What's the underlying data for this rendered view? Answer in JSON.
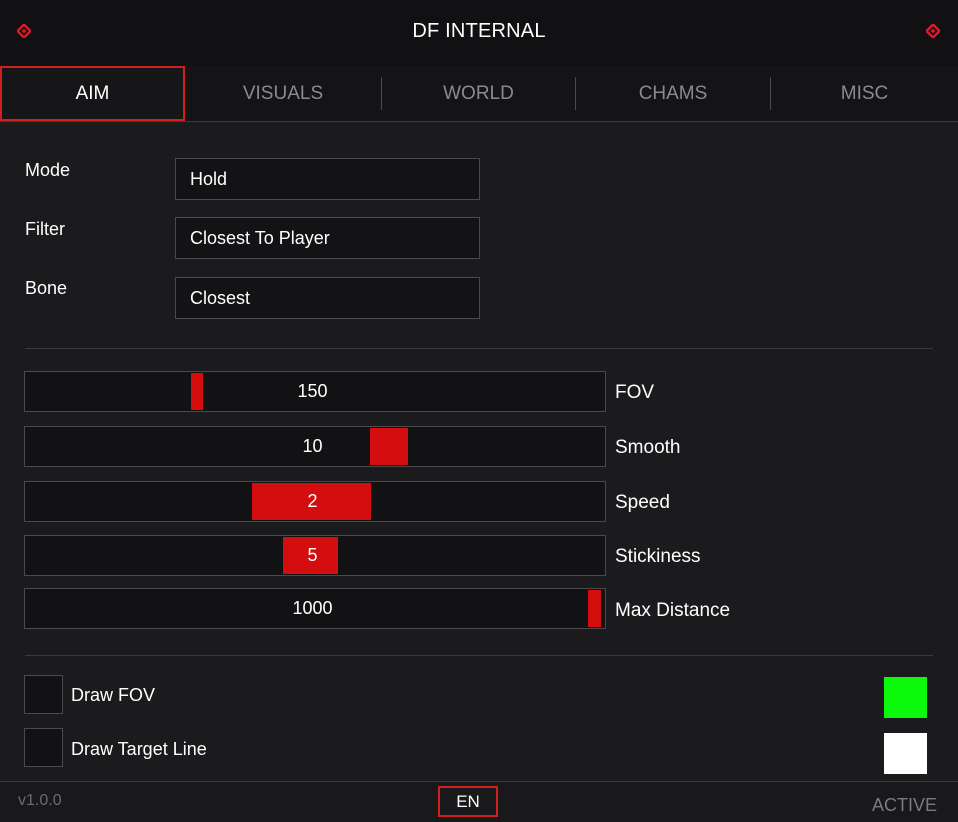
{
  "window": {
    "title": "DF INTERNAL",
    "left_icon": "diamond-icon",
    "right_icon": "diamond-icon",
    "accent_color": "#d21e1e"
  },
  "tabs": [
    {
      "label": "AIM",
      "active": true
    },
    {
      "label": "VISUALS",
      "active": false
    },
    {
      "label": "WORLD",
      "active": false
    },
    {
      "label": "CHAMS",
      "active": false
    },
    {
      "label": "MISC",
      "active": false
    }
  ],
  "fields": {
    "mode": {
      "label": "Mode",
      "value": "Hold"
    },
    "filter": {
      "label": "Filter",
      "value": "Closest To Player"
    },
    "bone": {
      "label": "Bone",
      "value": "Closest"
    }
  },
  "sliders": {
    "fov": {
      "label": "FOV",
      "value": "150"
    },
    "smooth": {
      "label": "Smooth",
      "value": "10"
    },
    "speed": {
      "label": "Speed",
      "value": "2"
    },
    "stickiness": {
      "label": "Stickiness",
      "value": "5"
    },
    "max_distance": {
      "label": "Max Distance",
      "value": "1000"
    }
  },
  "checkboxes": {
    "draw_fov": {
      "label": "Draw FOV",
      "checked": false,
      "color": "#0cf90c"
    },
    "draw_target_line": {
      "label": "Draw Target Line",
      "checked": false,
      "color": "#ffffff"
    }
  },
  "footer": {
    "version": "v1.0.0",
    "language": "EN",
    "status": "ACTIVE"
  }
}
